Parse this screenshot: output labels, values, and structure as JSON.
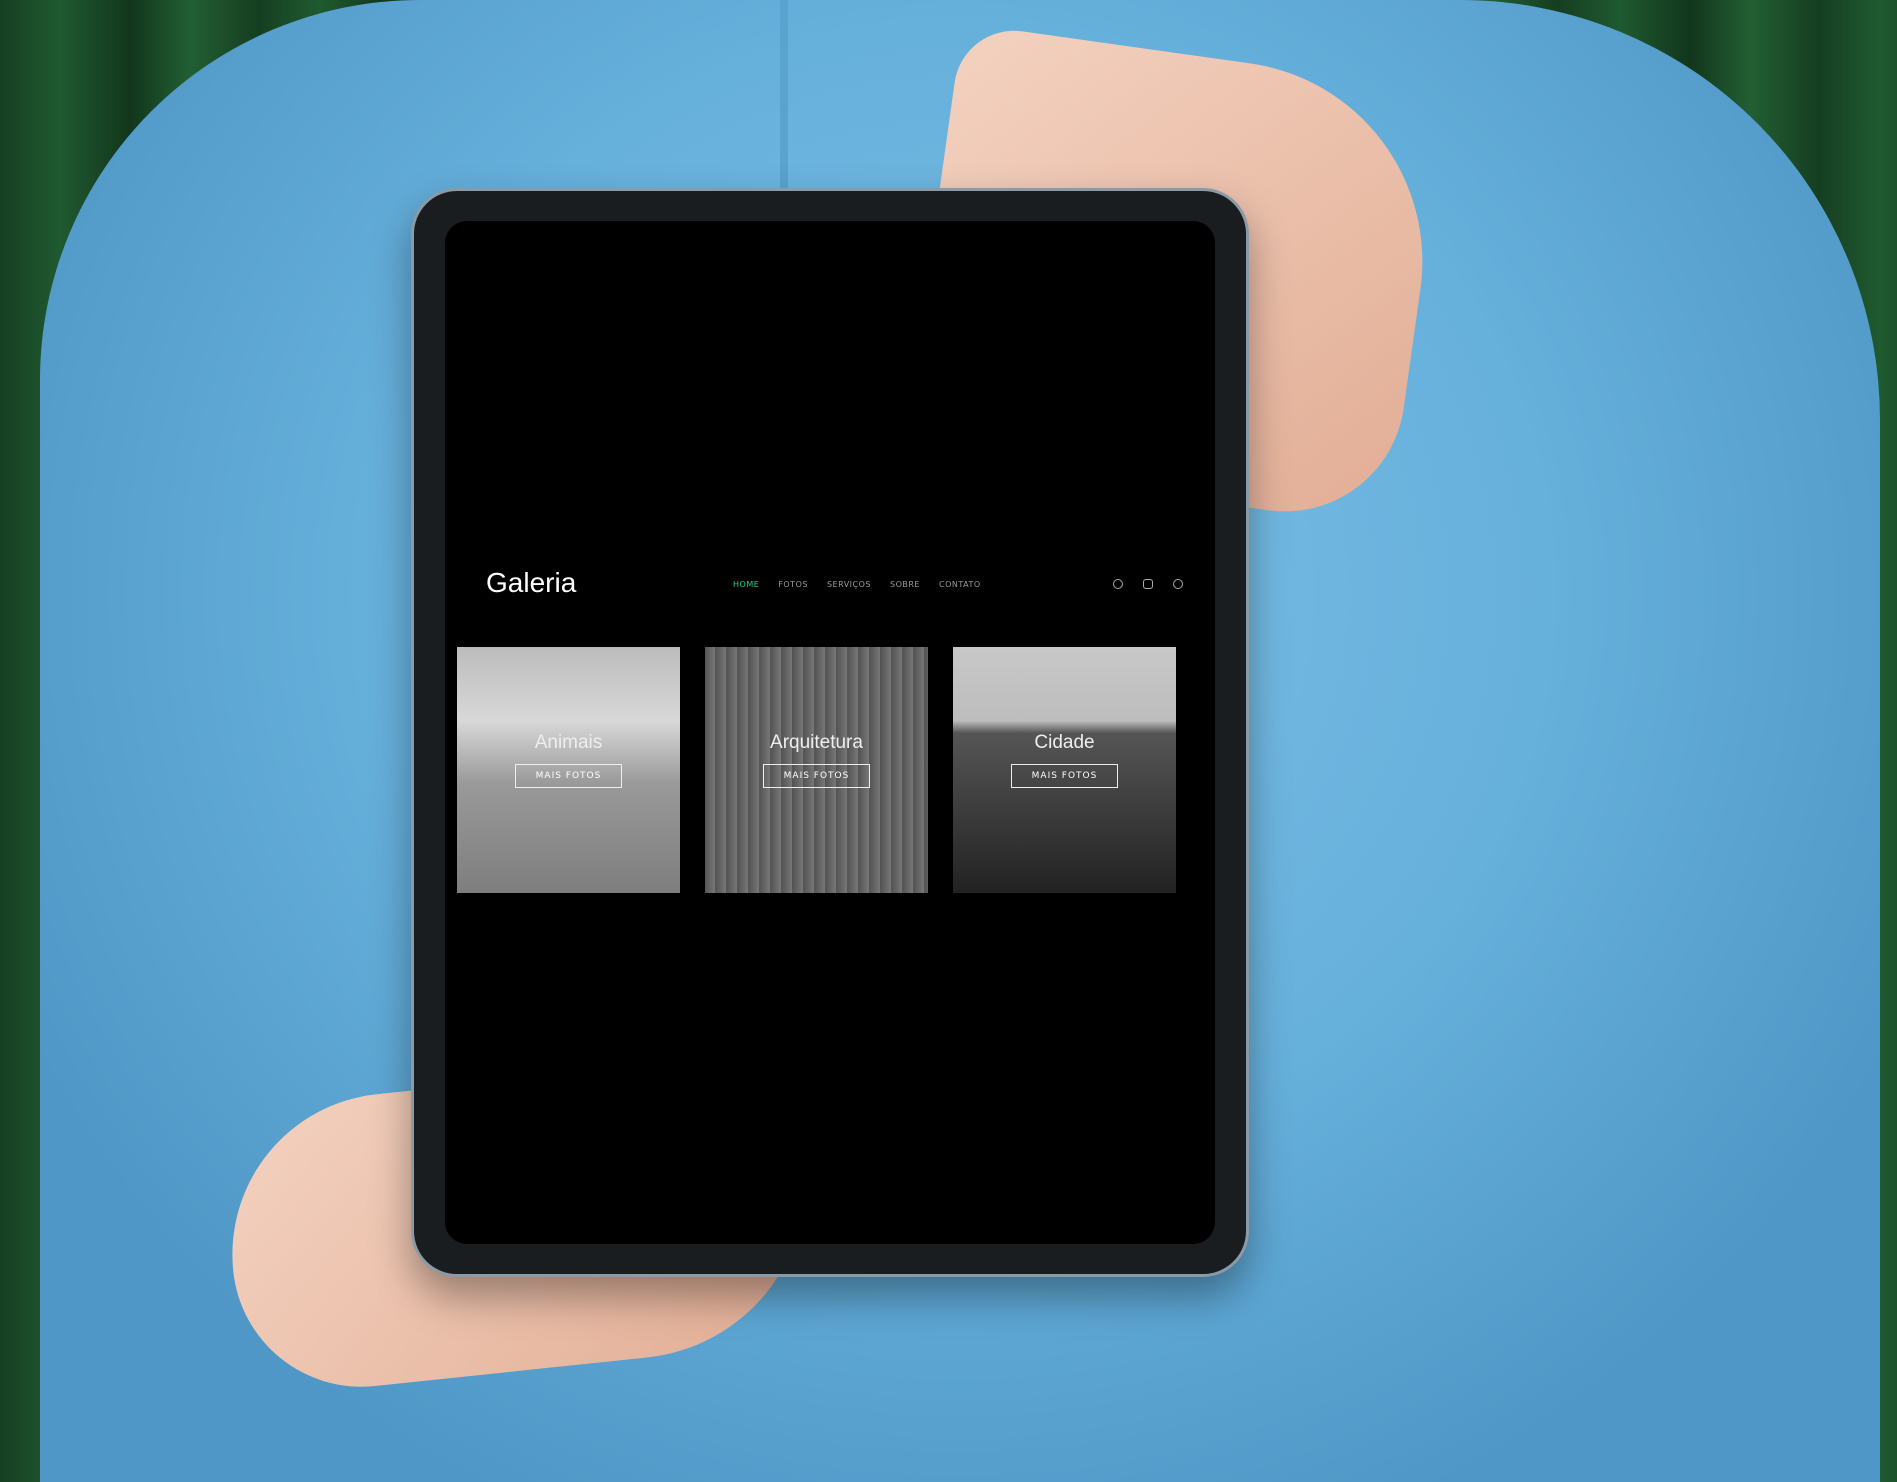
{
  "site": {
    "logo": "Galeria",
    "nav": [
      {
        "label": "HOME",
        "active": true
      },
      {
        "label": "FOTOS"
      },
      {
        "label": "SERVIÇOS"
      },
      {
        "label": "SOBRE"
      },
      {
        "label": "CONTATO"
      }
    ],
    "social_icons": [
      "github-icon",
      "instagram-icon",
      "facebook-icon"
    ],
    "accent": "#1fd18a"
  },
  "cards": [
    {
      "title": "Animais",
      "button": "MAIS FOTOS"
    },
    {
      "title": "Arquitetura",
      "button": "MAIS FOTOS"
    },
    {
      "title": "Cidade",
      "button": "MAIS FOTOS"
    }
  ]
}
